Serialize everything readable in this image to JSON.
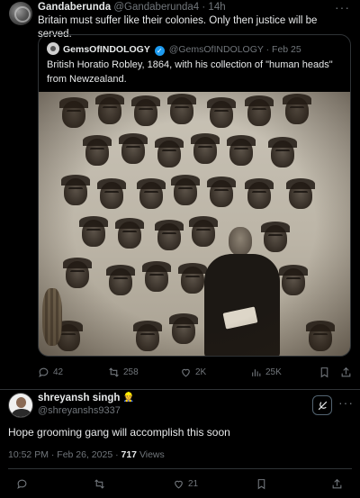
{
  "original_post": {
    "author_name": "Gandaberunda",
    "handle": "@Gandaberunda4",
    "time": "14h",
    "text": "Britain must suffer like their colonies. Only then justice will be served.",
    "more_icon": "more-horizontal-icon",
    "quoted_post": {
      "author_name": "GemsOfINDOLOGY",
      "verified": true,
      "handle": "@GemsOfINDOLOGY",
      "date": "Feb 25",
      "text": "British Horatio Robley, 1864, with his collection of \"human heads\" from Newzealand."
    },
    "actions": {
      "replies": "42",
      "reposts": "258",
      "likes": "2K",
      "views": "25K"
    }
  },
  "reply_post": {
    "author_name": "shreyansh singh",
    "emoji": "👷",
    "handle": "@shreyanshs9337",
    "text": "Hope grooming gang will accomplish this soon",
    "timestamp": "10:52 PM · Feb 26, 2025 · ",
    "views_count": "717",
    "views_label": " Views",
    "actions": {
      "likes": "21"
    }
  },
  "colors": {
    "background": "#000000",
    "text": "#e7e9ea",
    "muted": "#71767b",
    "border": "#2f3336",
    "verified": "#1d9bf0"
  }
}
